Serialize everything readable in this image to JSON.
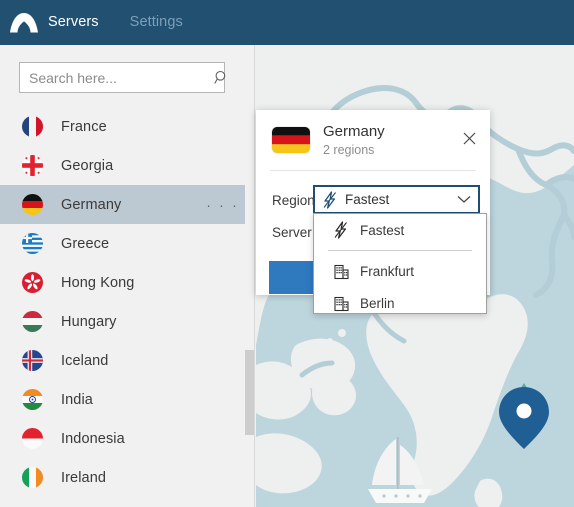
{
  "app": {
    "logo_icon": "nordvpn-arch-logo",
    "header_bg": "#215071"
  },
  "header": {
    "tabs": [
      {
        "label": "Servers",
        "active": true
      },
      {
        "label": "Settings",
        "active": false
      }
    ]
  },
  "sidebar": {
    "search": {
      "placeholder": "Search here...",
      "value": "",
      "icon": "search-icon"
    },
    "countries": [
      {
        "name": "France",
        "flag": "flag-france",
        "selected": false
      },
      {
        "name": "Georgia",
        "flag": "flag-georgia",
        "selected": false
      },
      {
        "name": "Germany",
        "flag": "flag-germany",
        "selected": true,
        "menu": "· · ·"
      },
      {
        "name": "Greece",
        "flag": "flag-greece",
        "selected": false
      },
      {
        "name": "Hong Kong",
        "flag": "flag-hongkong",
        "selected": false
      },
      {
        "name": "Hungary",
        "flag": "flag-hungary",
        "selected": false
      },
      {
        "name": "Iceland",
        "flag": "flag-iceland",
        "selected": false
      },
      {
        "name": "India",
        "flag": "flag-india",
        "selected": false
      },
      {
        "name": "Indonesia",
        "flag": "flag-indonesia",
        "selected": false
      },
      {
        "name": "Ireland",
        "flag": "flag-ireland",
        "selected": false
      }
    ],
    "scrollbar": {
      "visible": true
    }
  },
  "popup": {
    "flag": "flag-germany",
    "title": "Germany",
    "subtitle": "2 regions",
    "close_icon": "close-icon",
    "region_label": "Region:",
    "server_label": "Server:",
    "region_selected": "Fastest",
    "region_icon": "lightning-bolt-icon",
    "caret_icon": "chevron-down-icon",
    "dropdown": {
      "open": true,
      "options": [
        {
          "label": "Fastest",
          "icon": "lightning-bolt-icon",
          "separator_after": true
        },
        {
          "label": "Frankfurt",
          "icon": "building-icon",
          "separator_after": false
        },
        {
          "label": "Berlin",
          "icon": "building-icon",
          "separator_after": false
        }
      ]
    },
    "connect_button": {
      "label": "",
      "color": "#2f79bf"
    }
  },
  "map": {
    "land_color": "#eeefef",
    "sea_color": "#bdd5dd",
    "border_color": "#b3ced6",
    "pin_color": "#1f5f94",
    "pin_accent": "#5aa99b",
    "boat_color": "#f2f3f2",
    "pin_label": "location-pin",
    "boat_label": "sailboat"
  }
}
